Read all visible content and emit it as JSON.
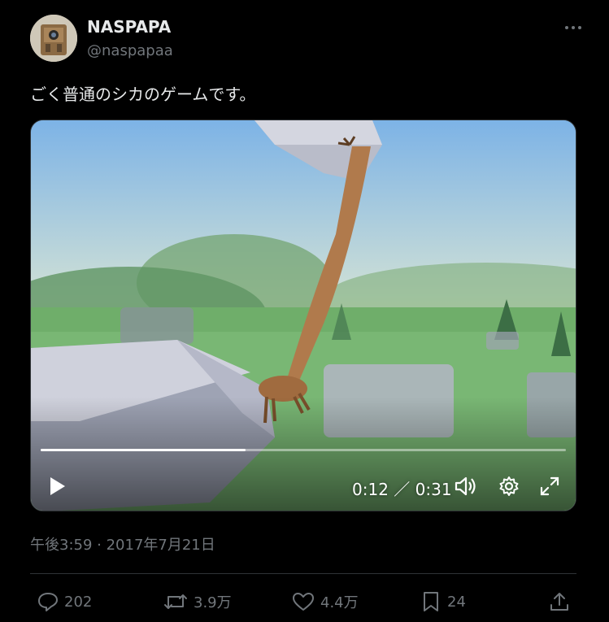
{
  "author": {
    "name": "NASPAPA",
    "handle": "@naspapaa"
  },
  "tweet": {
    "text": "ごく普通のシカのゲームです。",
    "timestamp": "午後3:59 · 2017年7月21日"
  },
  "video": {
    "time": "0:12 ／ 0:31",
    "progress": 0.39
  },
  "actions": {
    "replies": "202",
    "retweets": "3.9万",
    "likes": "4.4万",
    "bookmarks": "24"
  },
  "icons": [
    "more-icon",
    "play-icon",
    "volume-icon",
    "settings-gear-icon",
    "fullscreen-icon",
    "reply-icon",
    "retweet-icon",
    "like-heart-icon",
    "bookmark-icon",
    "share-icon"
  ]
}
